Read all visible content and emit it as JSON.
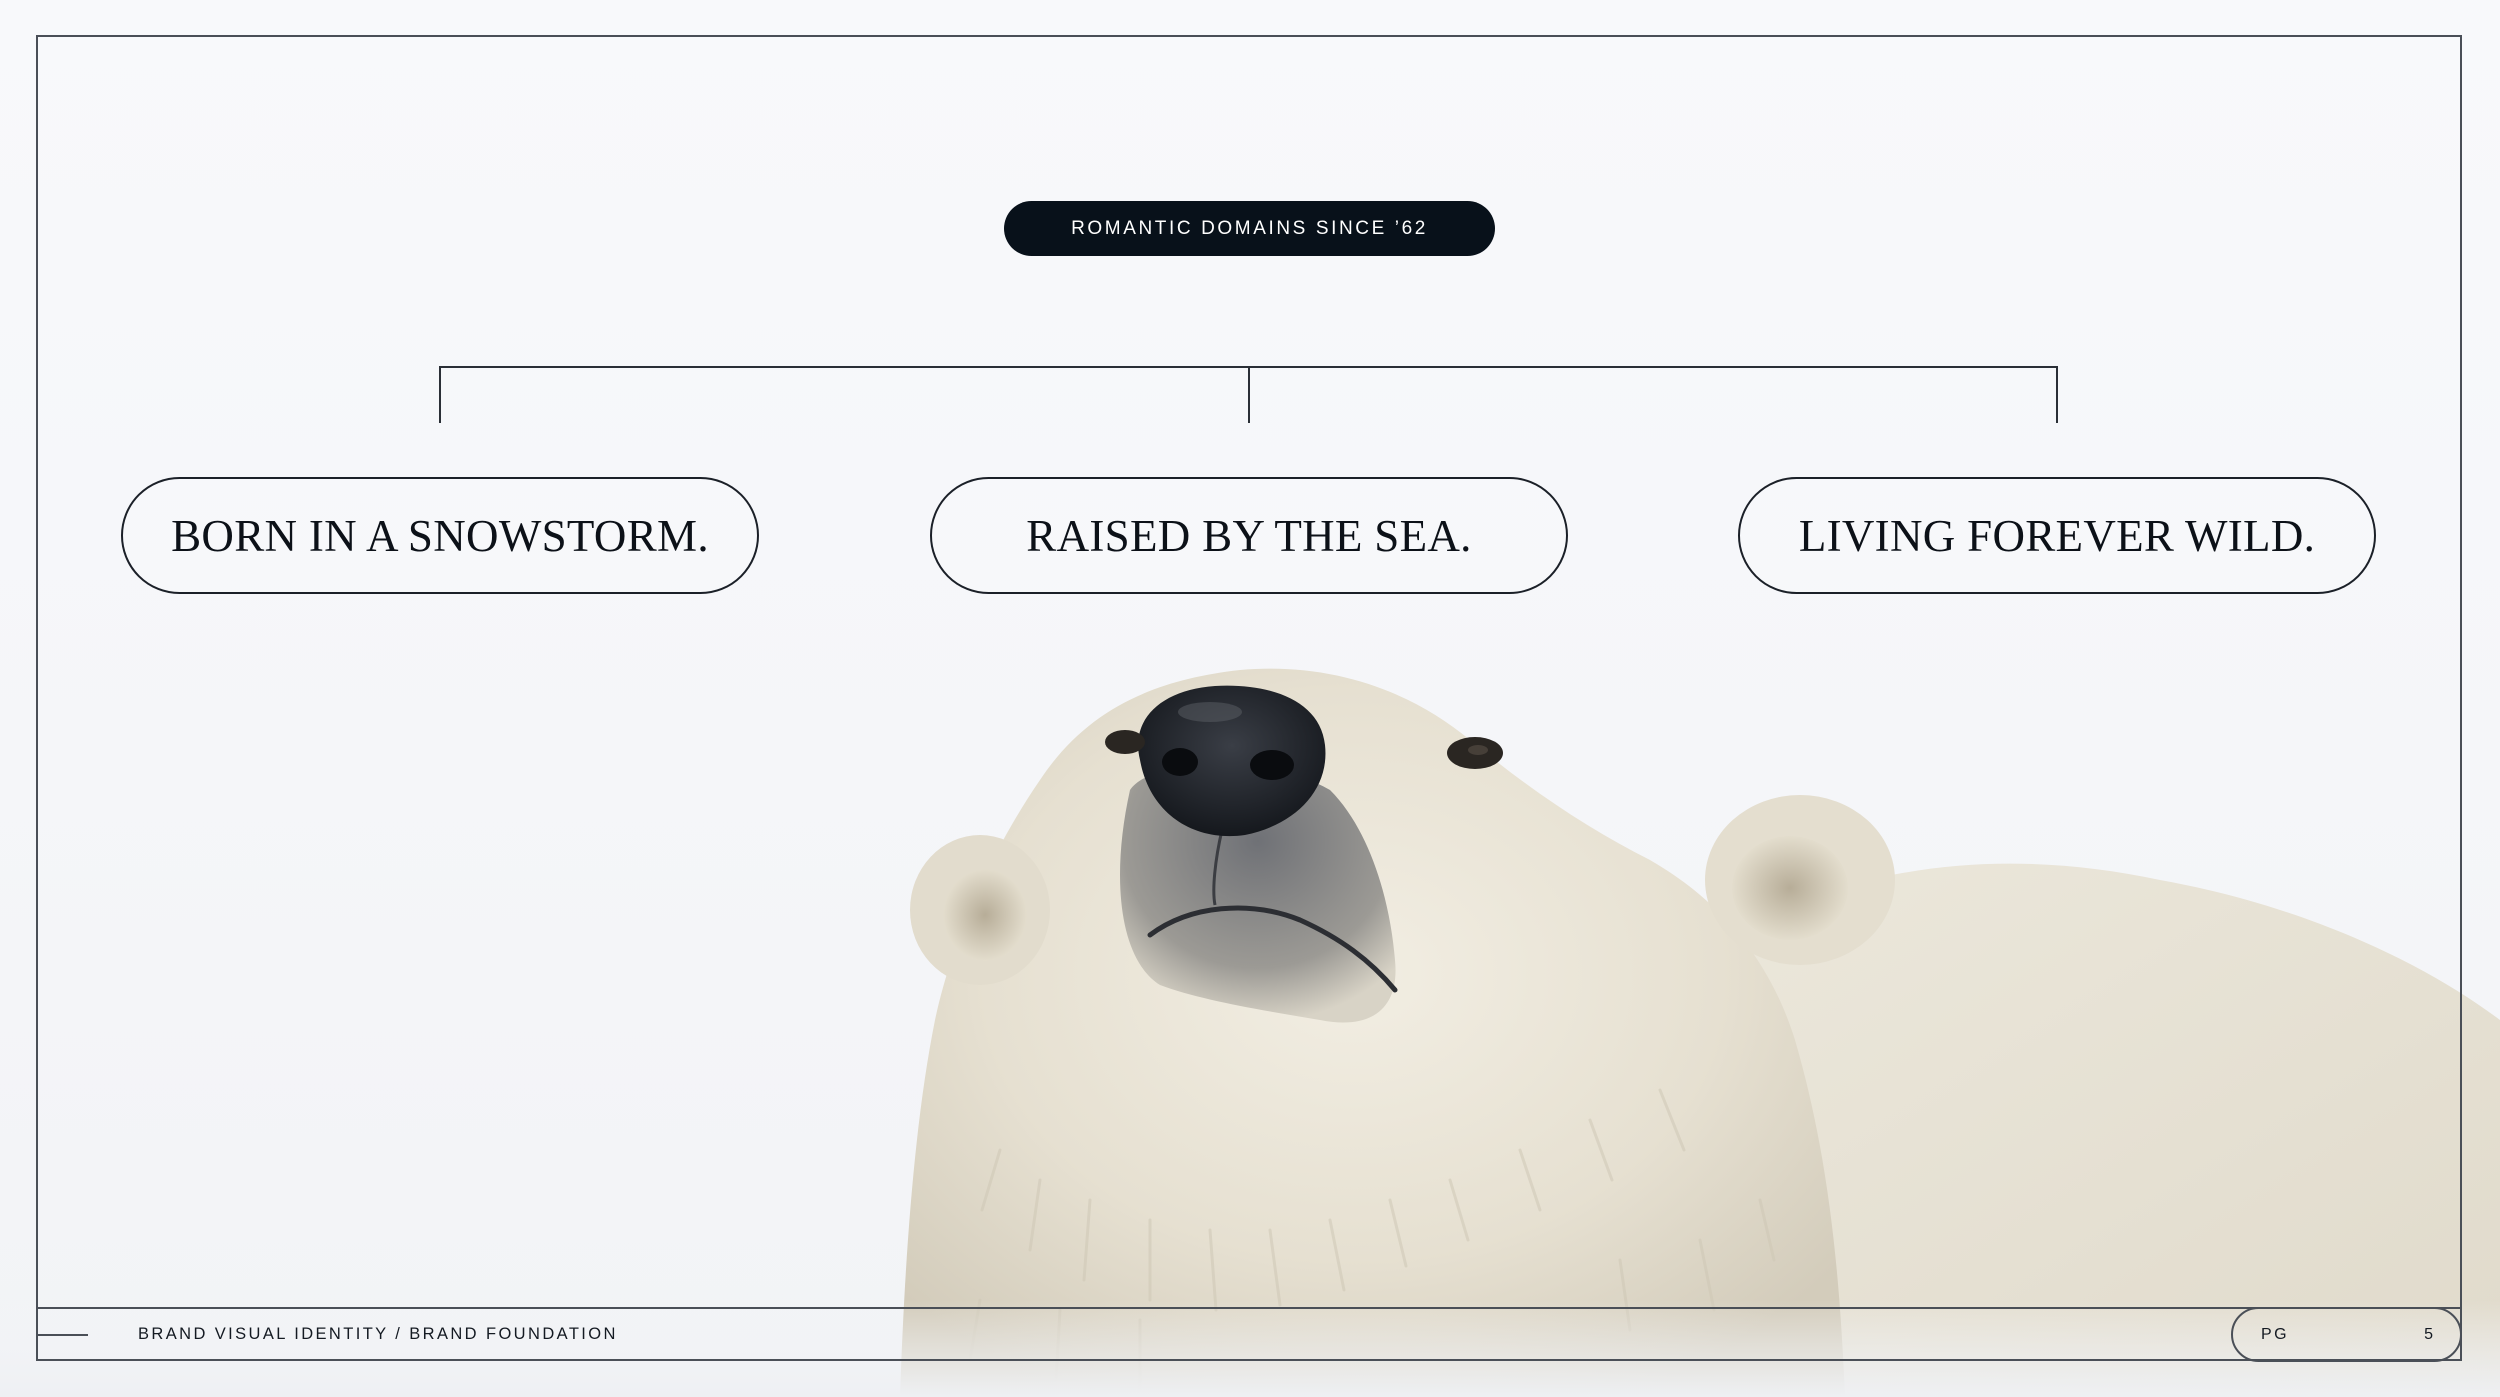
{
  "badge": {
    "label": "ROMANTIC DOMAINS SINCE ’62"
  },
  "pillars": [
    {
      "label": "BORN IN A SNOWSTORM."
    },
    {
      "label": "RAISED BY THE SEA."
    },
    {
      "label": "LIVING FOREVER WILD."
    }
  ],
  "footer": {
    "section": "BRAND VISUAL IDENTITY / BRAND FOUNDATION",
    "page_label": "PG",
    "page_number": "5"
  },
  "colors": {
    "ink": "#08111a",
    "background": "#f7f8fa",
    "rule": "#4a4f57"
  }
}
